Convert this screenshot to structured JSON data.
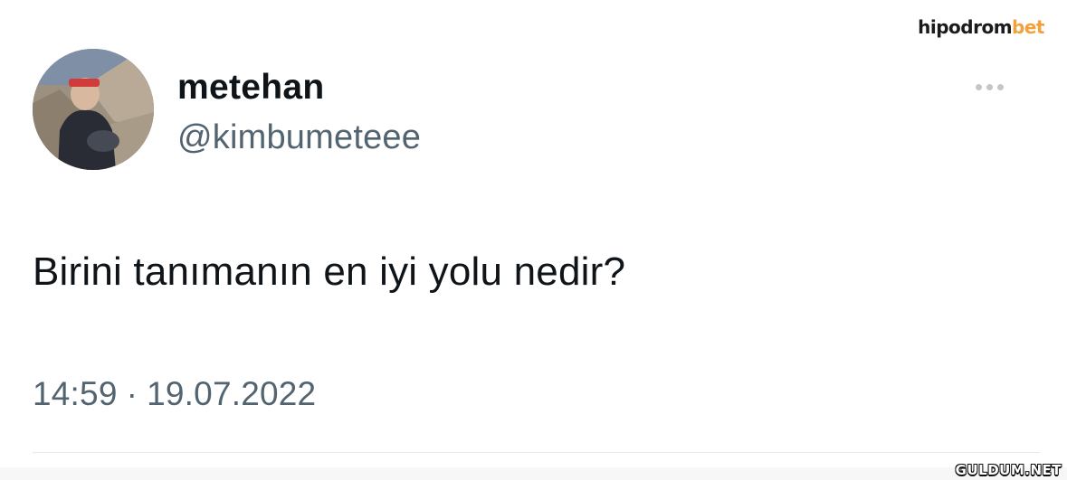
{
  "watermark": {
    "top_main": "hipodrom",
    "top_accent": "bet",
    "bottom": "GULDUM.NET"
  },
  "tweet": {
    "author": {
      "name": "metehan",
      "handle": "@kimbumeteee"
    },
    "text": "Birini tanımanın en iyi yolu nedir?",
    "time": "14:59",
    "separator": "·",
    "date": "19.07.2022"
  },
  "icons": {
    "more": "more-horizontal-icon"
  },
  "colors": {
    "text_primary": "#0f1419",
    "text_secondary": "#536471",
    "accent_watermark": "#f2a13c",
    "divider": "#e6e9eb"
  }
}
